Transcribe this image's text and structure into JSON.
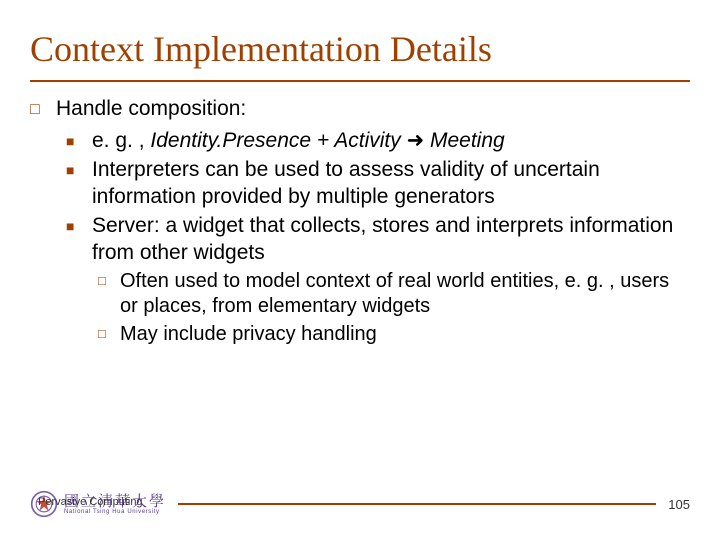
{
  "title": "Context Implementation Details",
  "content": {
    "l1": {
      "text": "Handle composition:"
    },
    "l2": [
      {
        "eg": "e. g. , ",
        "italic1": "Identity.Presence + Activity",
        "arrow": " ➜ ",
        "italic2": "Meeting"
      },
      {
        "text": "Interpreters can be used to assess validity of uncertain information provided by multiple generators"
      },
      {
        "text": "Server: a widget that collects, stores and interprets information from other widgets"
      }
    ],
    "l3": [
      {
        "text": "Often used to model context of real world entities, e. g. , users or places, from elementary widgets"
      },
      {
        "text": "May include privacy handling"
      }
    ]
  },
  "footer": {
    "label": "Pervasive Computing",
    "uni_cn": "國立清華大學",
    "uni_en": "National Tsing Hua University",
    "page": "105"
  },
  "colors": {
    "accent": "#A04000"
  }
}
